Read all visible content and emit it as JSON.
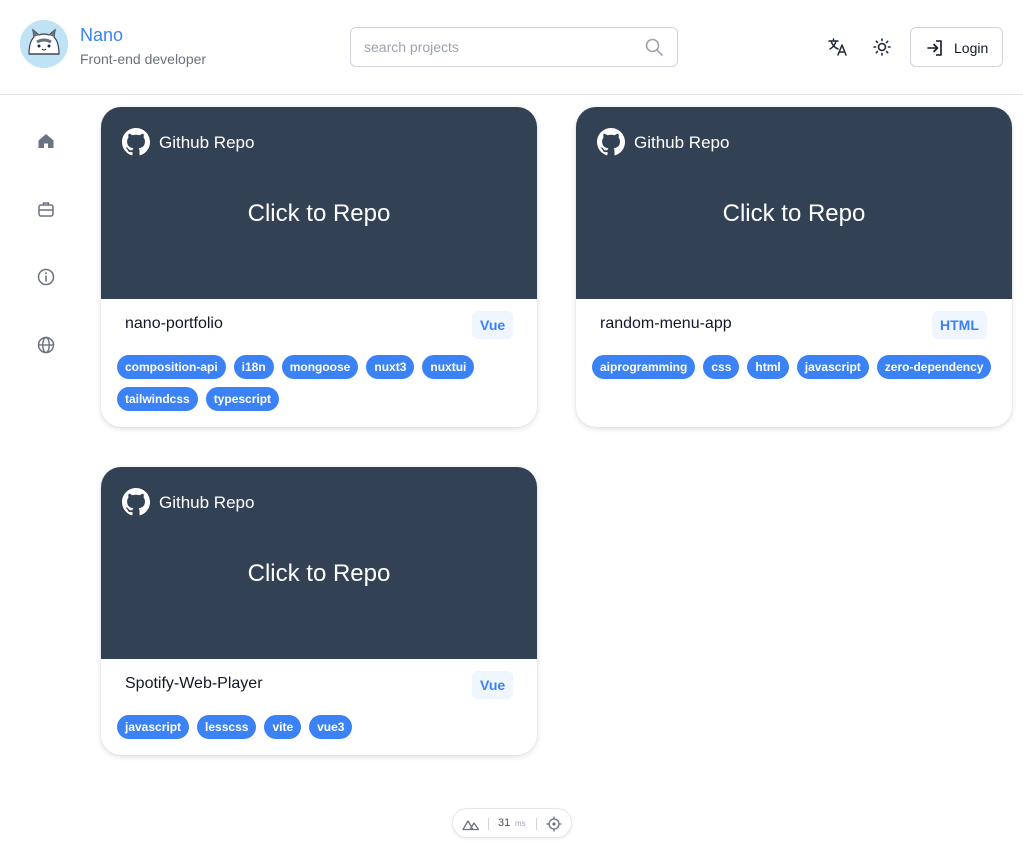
{
  "brand": {
    "name": "Nano",
    "subtitle": "Front-end developer"
  },
  "search": {
    "placeholder": "search projects",
    "value": ""
  },
  "header": {
    "login_label": "Login"
  },
  "sidebar": {
    "items": [
      "home-icon",
      "briefcase-icon",
      "info-icon",
      "globe-icon"
    ]
  },
  "cards": [
    {
      "header_label": "Github Repo",
      "overlay_label": "Click to Repo",
      "name": "nano-portfolio",
      "language": "Vue",
      "tags": [
        "composition-api",
        "i18n",
        "mongoose",
        "nuxt3",
        "nuxtui",
        "tailwindcss",
        "typescript"
      ]
    },
    {
      "header_label": "Github Repo",
      "overlay_label": "Click to Repo",
      "name": "random-menu-app",
      "language": "HTML",
      "tags": [
        "aiprogramming",
        "css",
        "html",
        "javascript",
        "zero-dependency"
      ]
    },
    {
      "header_label": "Github Repo",
      "overlay_label": "Click to Repo",
      "name": "Spotify-Web-Player",
      "language": "Vue",
      "tags": [
        "javascript",
        "lesscss",
        "vite",
        "vue3"
      ]
    }
  ],
  "devtools": {
    "render_time": "31",
    "unit": "ms"
  },
  "colors": {
    "accent": "#3b82f6",
    "card_header": "#334155",
    "badge_bg": "#eff6ff"
  }
}
